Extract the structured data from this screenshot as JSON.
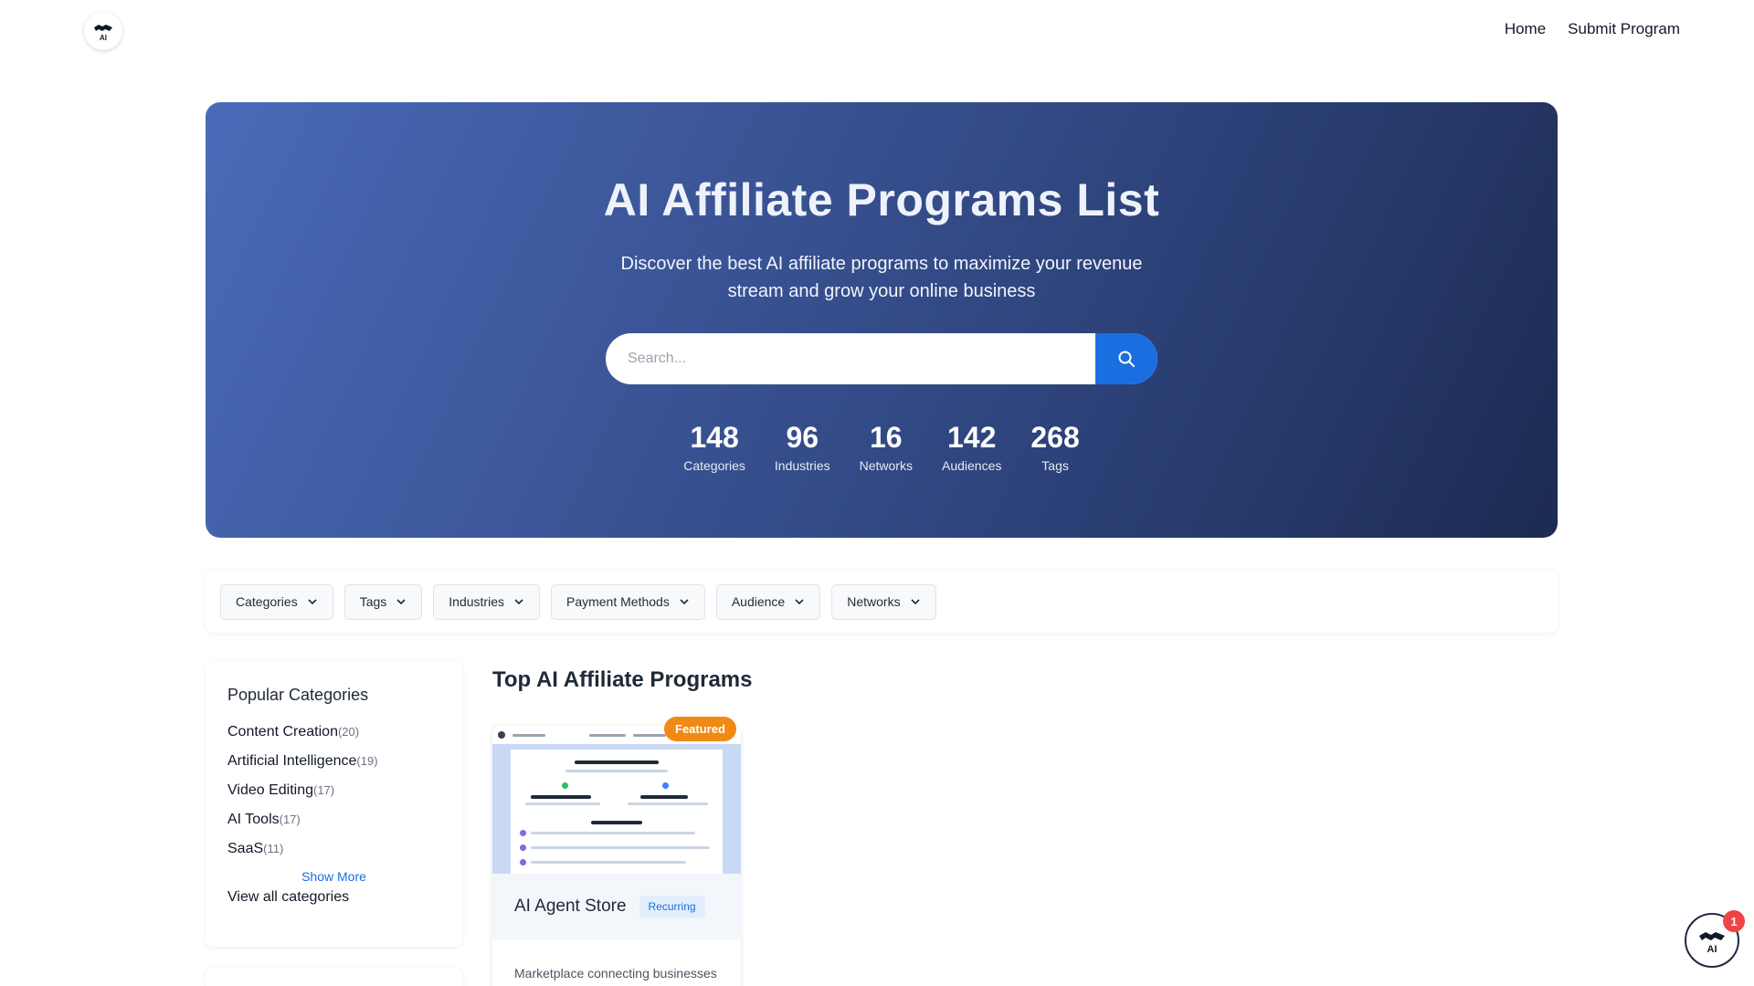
{
  "header": {
    "logo_text": "AI",
    "nav": [
      {
        "label": "Home"
      },
      {
        "label": "Submit Program"
      }
    ]
  },
  "hero": {
    "title": "AI Affiliate Programs List",
    "subtitle_line1": "Discover the best AI affiliate programs to maximize your revenue",
    "subtitle_line2": "stream and grow your online business",
    "search": {
      "placeholder": "Search...",
      "value": "",
      "button_icon": "search-icon"
    },
    "stats": [
      {
        "value": "148",
        "label": "Categories"
      },
      {
        "value": "96",
        "label": "Industries"
      },
      {
        "value": "16",
        "label": "Networks"
      },
      {
        "value": "142",
        "label": "Audiences"
      },
      {
        "value": "268",
        "label": "Tags"
      }
    ]
  },
  "filters": [
    {
      "label": "Categories"
    },
    {
      "label": "Tags"
    },
    {
      "label": "Industries"
    },
    {
      "label": "Payment Methods"
    },
    {
      "label": "Audience"
    },
    {
      "label": "Networks"
    }
  ],
  "sidebar": {
    "title": "Popular Categories",
    "categories": [
      {
        "name": "Content Creation",
        "count": "(20)"
      },
      {
        "name": "Artificial Intelligence",
        "count": "(19)"
      },
      {
        "name": "Video Editing",
        "count": "(17)"
      },
      {
        "name": "AI Tools",
        "count": "(17)"
      },
      {
        "name": "SaaS",
        "count": "(11)"
      }
    ],
    "show_more": "Show More",
    "view_all": "View all categories"
  },
  "main": {
    "section_title": "Top AI Affiliate Programs",
    "cards": [
      {
        "name": "AI Agent Store",
        "badge": "Featured",
        "tag": "Recurring",
        "description": "Marketplace connecting businesses with specialized AI"
      }
    ]
  },
  "floating": {
    "label": "AI",
    "notification_count": "1"
  },
  "colors": {
    "accent": "#1a6fe0",
    "badge": "#f08a14",
    "hero_start": "#4a6bb8",
    "hero_end": "#1d2b52",
    "notification": "#ef4444"
  }
}
